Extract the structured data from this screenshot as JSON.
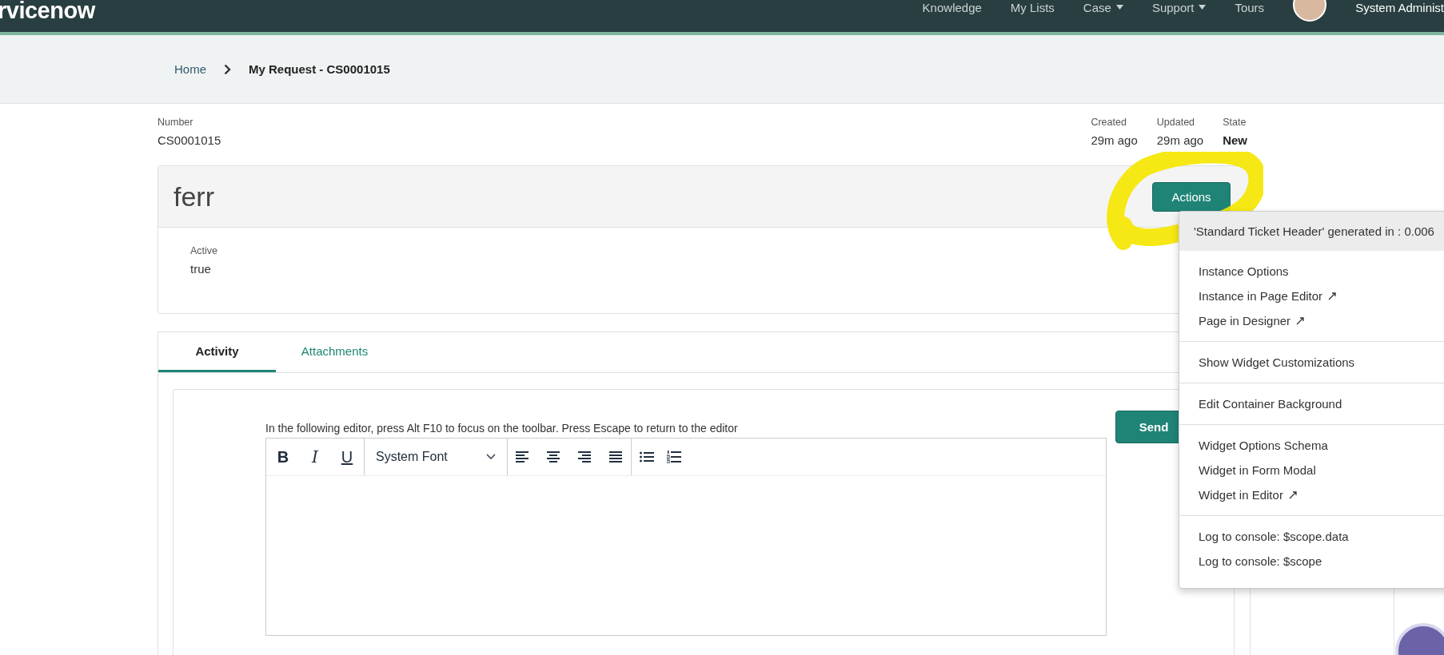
{
  "navbar": {
    "logo": "rvicenow",
    "links": [
      {
        "label": "Knowledge",
        "dropdown": false
      },
      {
        "label": "My Lists",
        "dropdown": false
      },
      {
        "label": "Case",
        "dropdown": true
      },
      {
        "label": "Support",
        "dropdown": true
      },
      {
        "label": "Tours",
        "dropdown": false
      }
    ],
    "user": "System Administ"
  },
  "breadcrumb": [
    {
      "label": "Home",
      "current": false
    },
    {
      "label": "My Request - CS0001015",
      "current": true
    }
  ],
  "record": {
    "number_label": "Number",
    "number": "CS0001015",
    "meta": [
      {
        "label": "Created",
        "value": "29m ago",
        "bold": false
      },
      {
        "label": "Updated",
        "value": "29m ago",
        "bold": false
      },
      {
        "label": "State",
        "value": "New",
        "bold": true
      }
    ]
  },
  "header_card": {
    "title": "ferr",
    "actions_button": "Actions",
    "fields": [
      {
        "label": "Active",
        "value": "true"
      }
    ]
  },
  "tabs": [
    {
      "label": "Activity",
      "selected": true
    },
    {
      "label": "Attachments",
      "selected": false
    }
  ],
  "editor": {
    "hint": "In the following editor, press Alt F10 to focus on the toolbar. Press Escape to return to the editor",
    "format_buttons": [
      "B",
      "I",
      "U"
    ],
    "font": "System Font",
    "send_button": "Send"
  },
  "context_menu": {
    "header": "'Standard Ticket Header' generated in : 0.006",
    "groups": [
      [
        {
          "label": "Instance Options",
          "external": false
        },
        {
          "label": "Instance in Page Editor",
          "external": true
        },
        {
          "label": "Page in Designer",
          "external": true
        }
      ],
      [
        {
          "label": "Show Widget Customizations",
          "external": false
        }
      ],
      [
        {
          "label": "Edit Container Background",
          "external": false
        }
      ],
      [
        {
          "label": "Widget Options Schema",
          "external": false
        },
        {
          "label": "Widget in Form Modal",
          "external": false
        },
        {
          "label": "Widget in Editor",
          "external": true
        }
      ],
      [
        {
          "label": "Log to console: $scope.data",
          "external": false
        },
        {
          "label": "Log to console: $scope",
          "external": false
        }
      ]
    ]
  }
}
